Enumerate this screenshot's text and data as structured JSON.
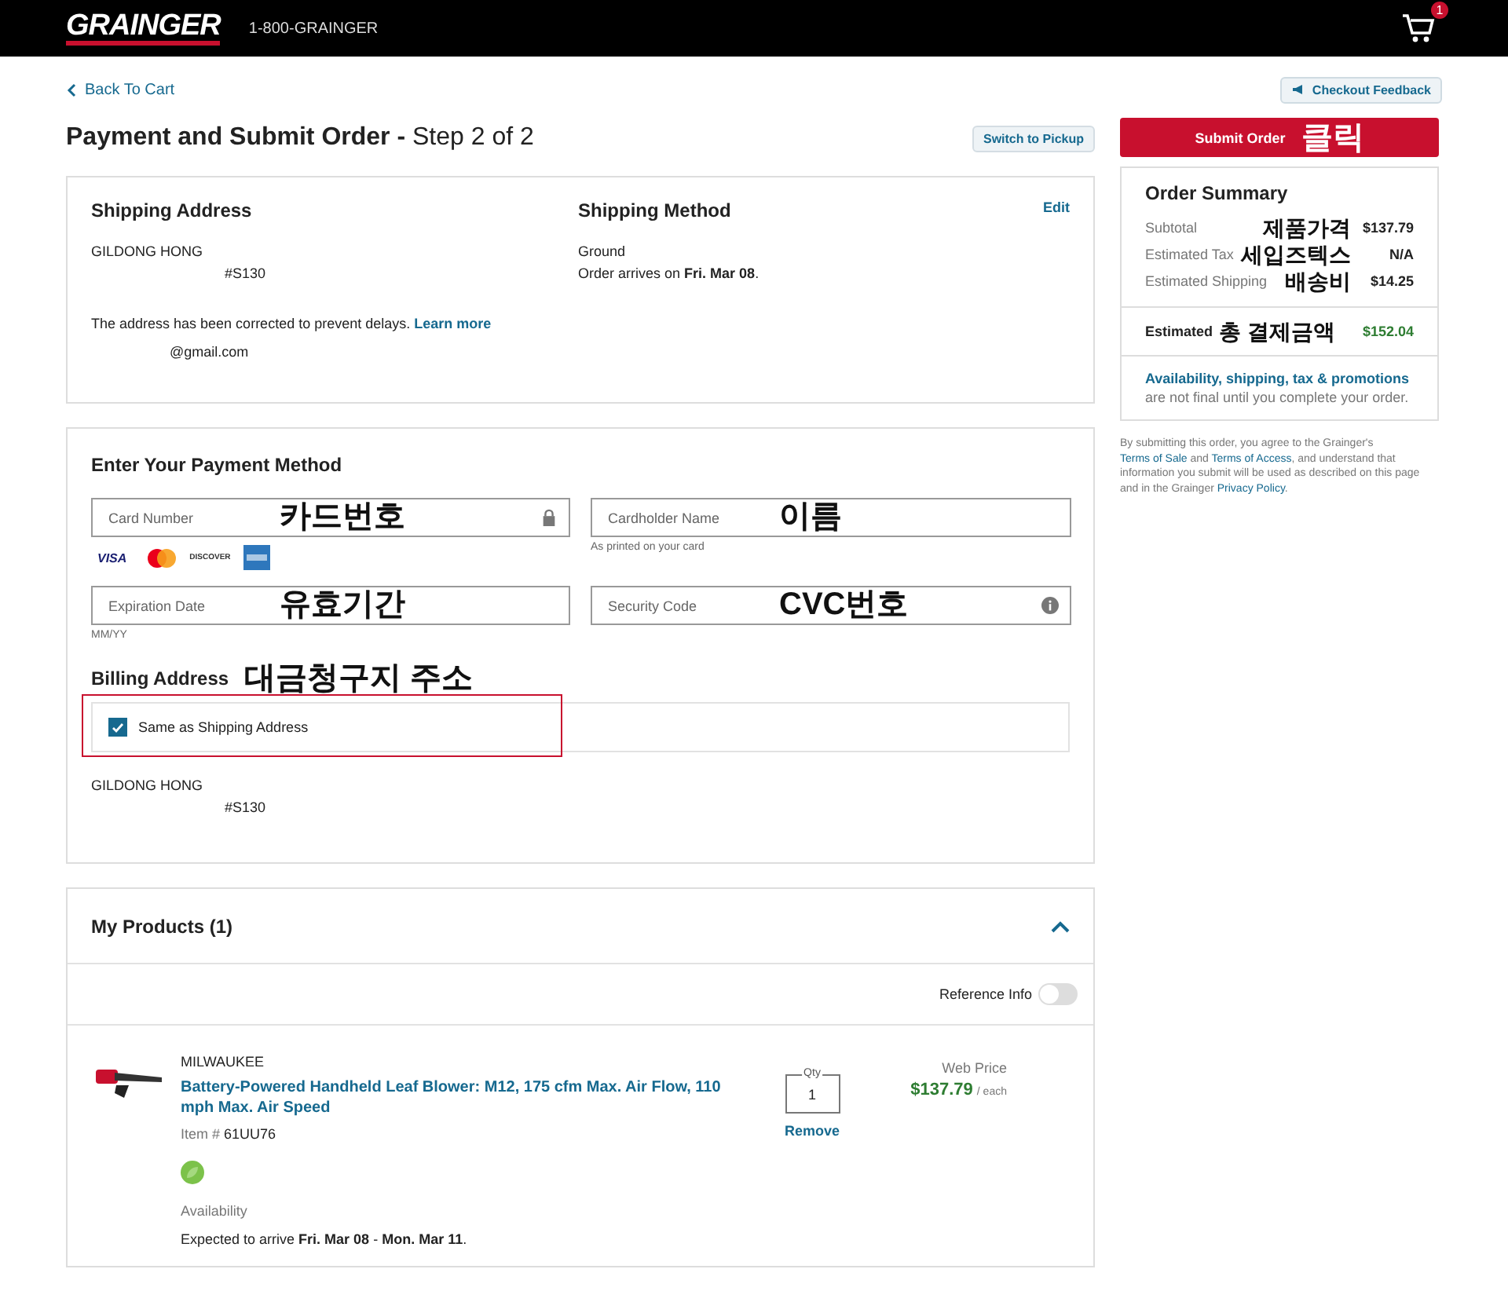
{
  "header": {
    "logo": "GRAINGER",
    "phone": "1-800-GRAINGER",
    "cart_count": "1"
  },
  "back_link": "Back To Cart",
  "feedback_button": "Checkout Feedback",
  "page_title": "**Payment and Submit Order -** Step 2 of 2",
  "switch_button": "Switch to Pickup",
  "shipping": {
    "address_heading": "Shipping Address",
    "name": "GILDONG HONG",
    "address_line": "#S130",
    "notice": [
      {
        "text": "The address has been corrected to prevent delays. ",
        "link": false
      },
      {
        "text": "Learn more",
        "link": true
      }
    ],
    "email": "@gmail.com",
    "method_heading": "Shipping Method",
    "edit_link": "Edit",
    "method": "Ground",
    "arrival": "Order arrives on **Fri. Mar 08**."
  },
  "payment": {
    "heading": "Enter Your Payment Method",
    "fields": [
      {
        "kind": "secure",
        "placeholder": "Card Number",
        "annotation": "카드번호"
      },
      {
        "kind": "plain",
        "placeholder": "Cardholder Name",
        "annotation": "이름",
        "hint": "As printed on your card"
      },
      {
        "kind": "plain",
        "placeholder": "Expiration Date",
        "annotation": "유효기간",
        "hint": "MM/YY"
      },
      {
        "kind": "help",
        "placeholder": "Security Code",
        "annotation": "CVC번호"
      }
    ],
    "card_logos": [
      {
        "kind": "visa",
        "text": "VISA"
      },
      {
        "kind": "mastercard"
      },
      {
        "kind": "discover",
        "text": "DISCOVER"
      },
      {
        "kind": "amex"
      }
    ],
    "billing_heading": "Billing Address",
    "billing_annotation": "대금청구지 주소",
    "same_as_shipping": {
      "label": "Same as Shipping Address",
      "checked": true,
      "highlighted": true
    },
    "billing_name": "GILDONG HONG",
    "billing_address_line": "#S130"
  },
  "products": {
    "heading": "My Products (1)",
    "expanded": true,
    "reference_info": {
      "label": "Reference Info",
      "on": false
    },
    "items": [
      {
        "brand": "MILWAUKEE",
        "title": "Battery-Powered Handheld Leaf Blower: M12, 175 cfm Max. Air Flow, 110 mph Max. Air Speed",
        "item_label": "Item #",
        "item_number": "61UU76",
        "availability_label": "Availability",
        "expected": "Expected to arrive **Fri. Mar 08** - **Mon. Mar 11**.",
        "qty_label": "Qty",
        "qty": "1",
        "remove": "Remove",
        "price_label": "Web Price",
        "price": "$137.79",
        "price_unit": "/ each"
      }
    ]
  },
  "submit": {
    "label": "Submit Order",
    "annotation": "클릭"
  },
  "summary": {
    "heading": "Order Summary",
    "rows": [
      {
        "label": "Subtotal",
        "annotation": "제품가격",
        "value": "$137.79"
      },
      {
        "label": "Estimated Tax",
        "annotation": "세입즈텍스",
        "value": "N/A"
      },
      {
        "label": "Estimated Shipping",
        "annotation": "배송비",
        "value": "$14.25"
      }
    ],
    "total": {
      "label": "Estimated",
      "annotation": "총 결제금액",
      "value": "$152.04"
    },
    "note": [
      {
        "text": "Availability, shipping, tax & promotions",
        "link": true
      },
      {
        "text": " are not final until you complete your order.",
        "link": false
      }
    ]
  },
  "legal": [
    {
      "text": "By submitting this order, you agree to the Grainger's ",
      "link": false
    },
    {
      "text": "Terms of Sale",
      "link": true
    },
    {
      "text": " and ",
      "link": false
    },
    {
      "text": "Terms of Access",
      "link": true
    },
    {
      "text": ", and understand that information you submit will be used as described on this page and in the Grainger ",
      "link": false
    },
    {
      "text": "Privacy Policy",
      "link": true
    },
    {
      "text": ".",
      "link": false
    }
  ]
}
